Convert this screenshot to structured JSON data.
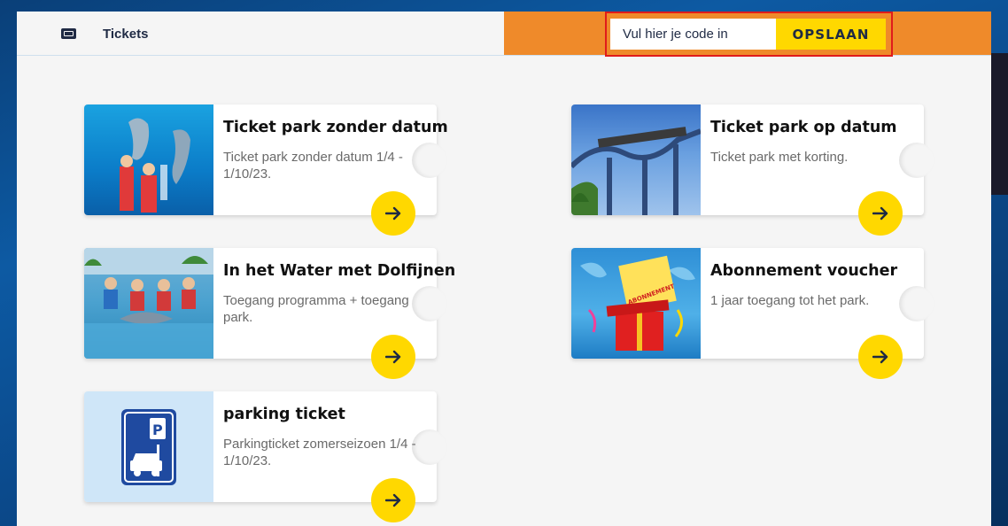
{
  "header": {
    "tab_label": "Tickets",
    "code_placeholder": "Vul hier je code in",
    "save_label": "OPSLAAN"
  },
  "cards": [
    {
      "title": "Ticket park zonder datum",
      "desc": "Ticket park zonder datum 1/4 - 1/10/23."
    },
    {
      "title": "Ticket park op datum",
      "desc": "Ticket park met korting."
    },
    {
      "title": "In het Water met Dolfijnen",
      "desc": "Toegang programma + toegang park."
    },
    {
      "title": "Abonnement voucher",
      "desc": "1 jaar toegang tot het park."
    },
    {
      "title": "parking ticket",
      "desc": "Parkingticket zomerseizoen 1/4 - 1/10/23."
    }
  ],
  "voucher_image_text": "ABONNEMENT",
  "colors": {
    "accent_orange": "#ef8a2a",
    "accent_yellow": "#ffd800",
    "highlight_red": "#e01b1b",
    "text_dark": "#1f2a44"
  }
}
